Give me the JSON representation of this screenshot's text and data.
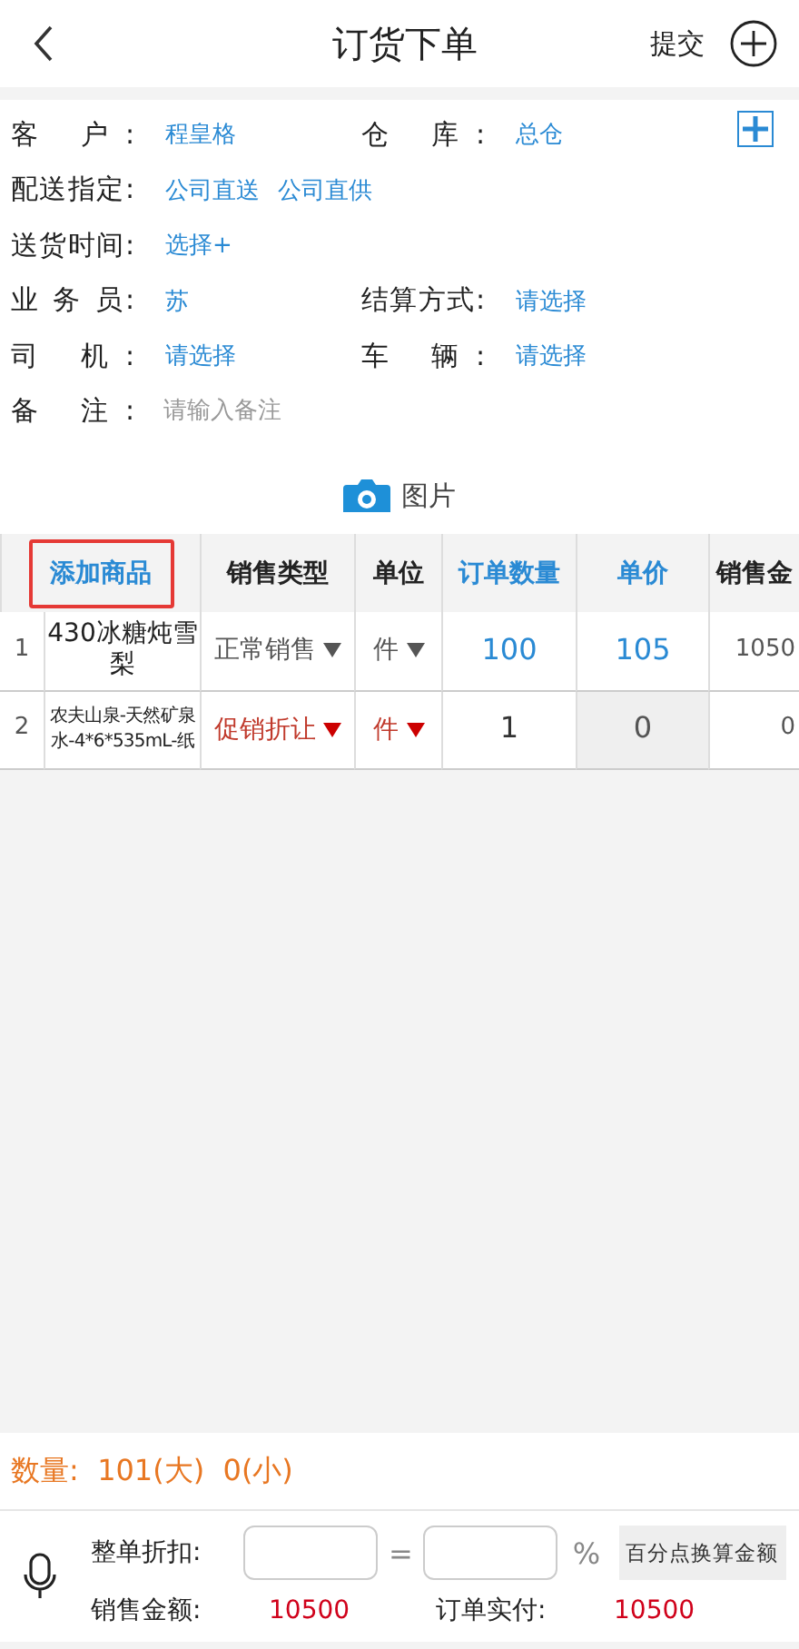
{
  "header": {
    "title": "订货下单",
    "submit": "提交"
  },
  "form": [
    {
      "label": "客 户:",
      "value": "程皇格",
      "label2": "仓 库:",
      "value2": "总仓",
      "kind": "pair"
    },
    {
      "label": "配送指定:",
      "options": [
        "公司直送",
        "公司直供"
      ],
      "kind": "options"
    },
    {
      "label": "送货时间:",
      "value": "选择+",
      "kind": "single"
    },
    {
      "label": "业 务 员:",
      "value": "苏",
      "label2": "结算方式:",
      "value2": "请选择",
      "kind": "pair"
    },
    {
      "label": "司 机:",
      "value": "请选择",
      "label2": "车 辆:",
      "value2": "请选择",
      "kind": "pair"
    },
    {
      "label": "备 注:",
      "placeholder": "请输入备注",
      "kind": "input"
    }
  ],
  "photo": "图片",
  "table": {
    "columns": [
      {
        "label": "添加商品",
        "link": true,
        "outlined": true
      },
      {
        "label": "销售类型",
        "link": false
      },
      {
        "label": "单位",
        "link": false
      },
      {
        "label": "订单数量",
        "link": true
      },
      {
        "label": "单价",
        "link": true
      },
      {
        "label": "销售金",
        "link": false
      }
    ],
    "rows": [
      {
        "index": "1",
        "product": "430冰糖炖雪梨",
        "sale_type": "正常销售",
        "unit": "件",
        "qty": "100",
        "price": "105",
        "amount": "1050",
        "kind": "normal"
      },
      {
        "index": "2",
        "product": "农夫山泉-天然矿泉水-4*6*535mL-纸",
        "sale_type": "促销折让",
        "unit": "件",
        "qty": "1",
        "price": "0",
        "amount": "0",
        "kind": "promo"
      }
    ]
  },
  "summary": "数量:  101(大)  0(小)",
  "footer": {
    "discount_label": "整单折扣:",
    "equals": "=",
    "percent": "%",
    "convert_button": "百分点换算金额",
    "sales_label": "销售金额:",
    "sales_value": "10500",
    "paid_label": "订单实付:",
    "paid_value": "10500"
  }
}
